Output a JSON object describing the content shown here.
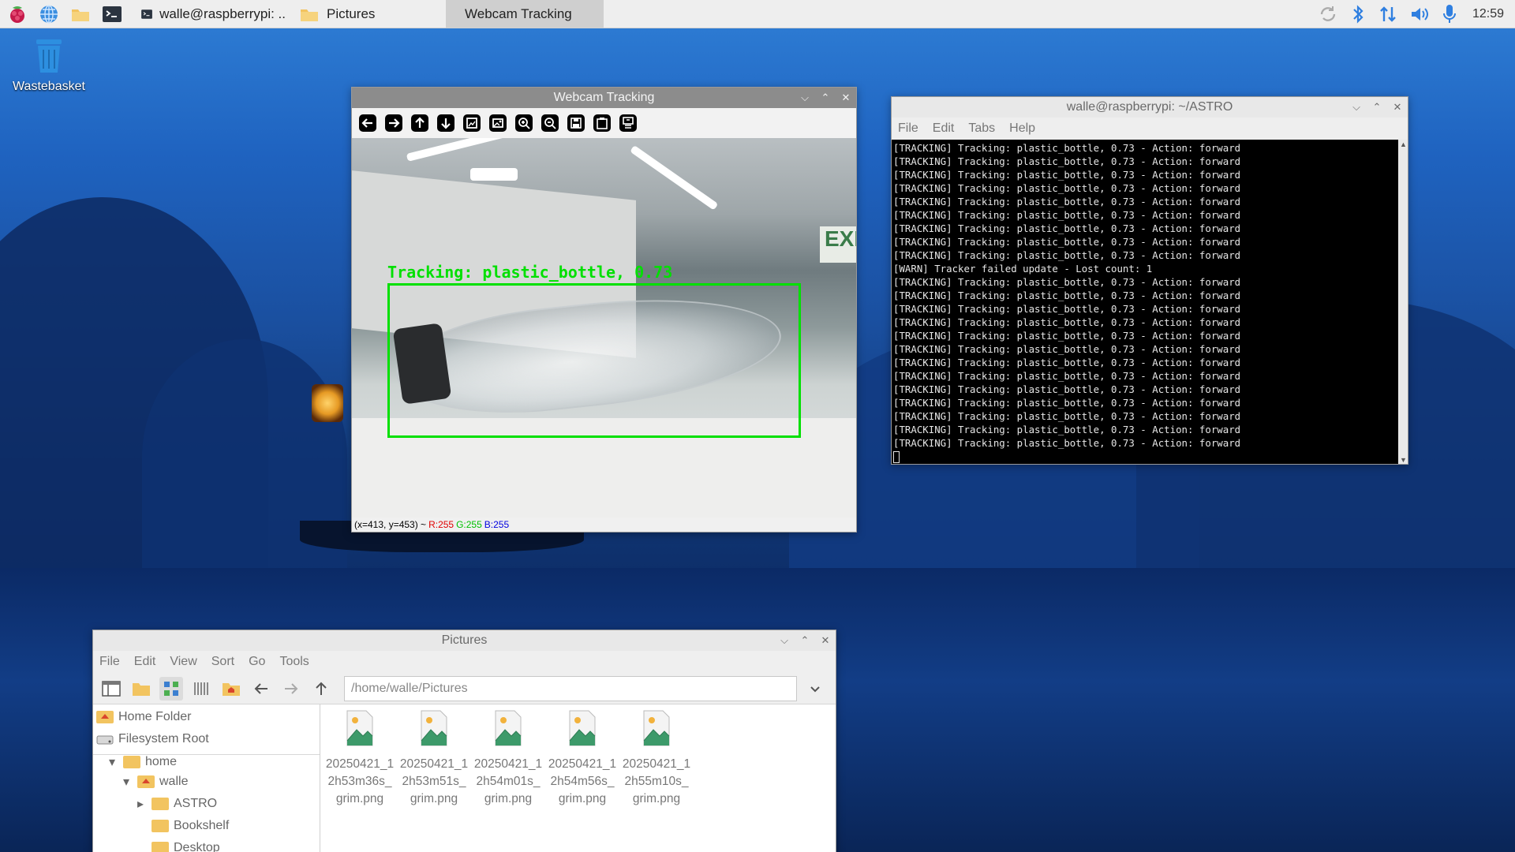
{
  "taskbar": {
    "buttons": [
      {
        "label": "walle@raspberrypi: ..",
        "icon": "terminal-icon"
      },
      {
        "label": "Pictures",
        "icon": "folder-icon"
      },
      {
        "label": "Webcam Tracking",
        "icon": ""
      }
    ],
    "clock": "12:59"
  },
  "desktop": {
    "icons": [
      {
        "label": "Wastebasket",
        "icon": "trash-icon"
      }
    ]
  },
  "webcam_window": {
    "title": "Webcam Tracking",
    "overlay_label": "Tracking: plastic_bottle, 0.73",
    "status": {
      "coords": "(x=413, y=453) ~",
      "r": "R:255",
      "g": "G:255",
      "b": "B:255"
    },
    "toolbar_icons": [
      "arrow-left-icon",
      "arrow-right-icon",
      "arrow-up-icon",
      "arrow-down-icon",
      "zoom-fit-icon",
      "zoom-original-icon",
      "zoom-in-icon",
      "zoom-out-icon",
      "save-icon",
      "copy-icon",
      "properties-icon"
    ]
  },
  "terminal_window": {
    "title": "walle@raspberrypi: ~/ASTRO",
    "menu": [
      "File",
      "Edit",
      "Tabs",
      "Help"
    ],
    "lines": [
      "[TRACKING] Tracking: plastic_bottle, 0.73 - Action: forward",
      "[TRACKING] Tracking: plastic_bottle, 0.73 - Action: forward",
      "[TRACKING] Tracking: plastic_bottle, 0.73 - Action: forward",
      "[TRACKING] Tracking: plastic_bottle, 0.73 - Action: forward",
      "[TRACKING] Tracking: plastic_bottle, 0.73 - Action: forward",
      "[TRACKING] Tracking: plastic_bottle, 0.73 - Action: forward",
      "[TRACKING] Tracking: plastic_bottle, 0.73 - Action: forward",
      "[TRACKING] Tracking: plastic_bottle, 0.73 - Action: forward",
      "[TRACKING] Tracking: plastic_bottle, 0.73 - Action: forward",
      "[WARN] Tracker failed update - Lost count: 1",
      "[TRACKING] Tracking: plastic_bottle, 0.73 - Action: forward",
      "[TRACKING] Tracking: plastic_bottle, 0.73 - Action: forward",
      "[TRACKING] Tracking: plastic_bottle, 0.73 - Action: forward",
      "[TRACKING] Tracking: plastic_bottle, 0.73 - Action: forward",
      "[TRACKING] Tracking: plastic_bottle, 0.73 - Action: forward",
      "[TRACKING] Tracking: plastic_bottle, 0.73 - Action: forward",
      "[TRACKING] Tracking: plastic_bottle, 0.73 - Action: forward",
      "[TRACKING] Tracking: plastic_bottle, 0.73 - Action: forward",
      "[TRACKING] Tracking: plastic_bottle, 0.73 - Action: forward",
      "[TRACKING] Tracking: plastic_bottle, 0.73 - Action: forward",
      "[TRACKING] Tracking: plastic_bottle, 0.73 - Action: forward",
      "[TRACKING] Tracking: plastic_bottle, 0.73 - Action: forward",
      "[TRACKING] Tracking: plastic_bottle, 0.73 - Action: forward"
    ]
  },
  "files_window": {
    "title": "Pictures",
    "menu": [
      "File",
      "Edit",
      "View",
      "Sort",
      "Go",
      "Tools"
    ],
    "path": "/home/walle/Pictures",
    "sidebar": {
      "places": [
        {
          "label": "Home Folder",
          "icon": "home-folder-icon"
        },
        {
          "label": "Filesystem Root",
          "icon": "drive-icon"
        }
      ],
      "tree": [
        {
          "label": "home",
          "expander": "▾"
        },
        {
          "label": "walle",
          "expander": "▾"
        },
        {
          "label": "ASTRO",
          "expander": "▸"
        },
        {
          "label": "Bookshelf",
          "expander": ""
        },
        {
          "label": "Desktop",
          "expander": ""
        }
      ]
    },
    "files": [
      "20250421_12h53m36s_grim.png",
      "20250421_12h53m51s_grim.png",
      "20250421_12h54m01s_grim.png",
      "20250421_12h54m56s_grim.png",
      "20250421_12h55m10s_grim.png"
    ]
  },
  "colors": {
    "bbox": "#00e000",
    "status_r": "#e00000",
    "status_g": "#00c000",
    "status_b": "#0000e0"
  }
}
